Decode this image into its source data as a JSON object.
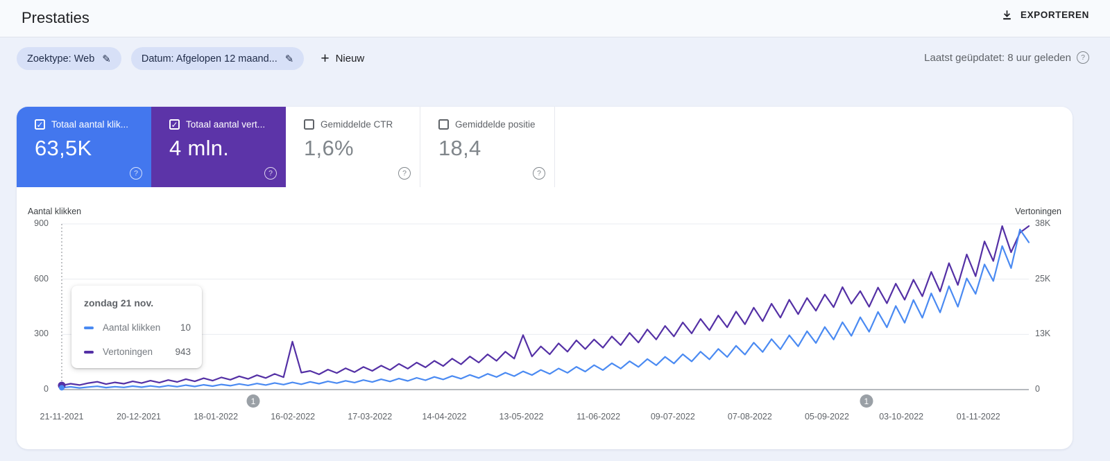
{
  "header": {
    "title": "Prestaties",
    "export_label": "EXPORTEREN"
  },
  "filters": {
    "chips": [
      {
        "label": "Zoektype: Web"
      },
      {
        "label": "Datum: Afgelopen 12 maand..."
      }
    ],
    "new_label": "Nieuw",
    "updated": "Laatst geüpdatet: 8 uur geleden"
  },
  "cards": [
    {
      "label": "Totaal aantal klik...",
      "value": "63,5K",
      "checked": true,
      "bg": "#4377ee"
    },
    {
      "label": "Totaal aantal vert...",
      "value": "4 mln.",
      "checked": true,
      "bg": "#5c34a8"
    },
    {
      "label": "Gemiddelde CTR",
      "value": "1,6%",
      "checked": false,
      "bg": ""
    },
    {
      "label": "Gemiddelde positie",
      "value": "18,4",
      "checked": false,
      "bg": ""
    }
  ],
  "tooltip": {
    "title": "zondag 21 nov.",
    "rows": [
      {
        "label": "Aantal klikken",
        "value": "10",
        "color": "#4a8af2"
      },
      {
        "label": "Vertoningen",
        "value": "943",
        "color": "#5430a5"
      }
    ]
  },
  "chart_data": {
    "type": "line",
    "grid": true,
    "legend_position": "none",
    "left_axis": {
      "title": "Aantal klikken",
      "ticks": [
        "0",
        "300",
        "600",
        "900"
      ],
      "range": [
        0,
        900
      ]
    },
    "right_axis": {
      "title": "Vertoningen",
      "ticks": [
        "0",
        "13K",
        "25K",
        "38K"
      ],
      "range": [
        0,
        38000
      ]
    },
    "x_axis": {
      "tick_labels": [
        "21-11-2021",
        "20-12-2021",
        "18-01-2022",
        "16-02-2022",
        "17-03-2022",
        "14-04-2022",
        "13-05-2022",
        "11-06-2022",
        "09-07-2022",
        "07-08-2022",
        "05-09-2022",
        "03-10-2022",
        "01-11-2022"
      ],
      "tick_days": [
        0,
        29,
        58,
        87,
        116,
        144,
        173,
        202,
        230,
        259,
        288,
        316,
        345
      ],
      "total_days": 364
    },
    "annotations": [
      {
        "label": "1",
        "pos": 0.198
      },
      {
        "label": "1",
        "pos": 0.832
      }
    ],
    "crosshair": {
      "pos": 0,
      "clicks": 10,
      "impressions": 943
    },
    "series": [
      {
        "name": "Aantal klikken",
        "axis": "left",
        "color": "#4a8af2",
        "values": [
          10,
          15,
          9,
          14,
          18,
          11,
          16,
          12,
          19,
          13,
          20,
          14,
          22,
          16,
          24,
          17,
          26,
          19,
          28,
          21,
          31,
          23,
          33,
          25,
          36,
          27,
          39,
          29,
          42,
          32,
          45,
          35,
          48,
          38,
          52,
          41,
          56,
          44,
          60,
          47,
          64,
          51,
          69,
          55,
          74,
          59,
          80,
          63,
          86,
          68,
          92,
          73,
          99,
          79,
          107,
          85,
          115,
          91,
          124,
          98,
          133,
          106,
          143,
          114,
          154,
          123,
          166,
          132,
          178,
          142,
          192,
          153,
          206,
          164,
          221,
          177,
          238,
          190,
          255,
          204,
          274,
          219,
          295,
          235,
          317,
          253,
          340,
          272,
          366,
          292,
          393,
          314,
          422,
          338,
          454,
          363,
          487,
          390,
          523,
          419,
          562,
          450,
          604,
          520,
          680,
          590,
          780,
          660,
          870,
          800
        ]
      },
      {
        "name": "Vertoningen",
        "axis": "right",
        "color": "#5430a5",
        "values": [
          943,
          1350,
          1050,
          1500,
          1800,
          1250,
          1650,
          1350,
          1900,
          1500,
          2050,
          1600,
          2200,
          1750,
          2400,
          1900,
          2600,
          2050,
          2800,
          2250,
          3050,
          2450,
          3300,
          2650,
          3600,
          2850,
          11000,
          3900,
          4300,
          3500,
          4600,
          3800,
          4900,
          4000,
          5200,
          4300,
          5500,
          4500,
          5900,
          4800,
          6200,
          5100,
          6600,
          5400,
          7100,
          5800,
          7600,
          6200,
          8100,
          6600,
          8700,
          7100,
          12500,
          7600,
          9900,
          8100,
          10600,
          8700,
          11300,
          9300,
          11500,
          9600,
          12200,
          10200,
          13000,
          10800,
          13800,
          11500,
          14600,
          12200,
          15400,
          12900,
          16200,
          13600,
          17000,
          14300,
          17900,
          15000,
          18800,
          15700,
          19700,
          16500,
          20600,
          17300,
          21000,
          18100,
          21800,
          18900,
          23500,
          19700,
          22600,
          19000,
          23400,
          19800,
          24300,
          20600,
          25200,
          21400,
          27000,
          22500,
          29000,
          24000,
          31000,
          26000,
          34000,
          29500,
          37500,
          31500,
          36000,
          37500
        ]
      }
    ]
  }
}
